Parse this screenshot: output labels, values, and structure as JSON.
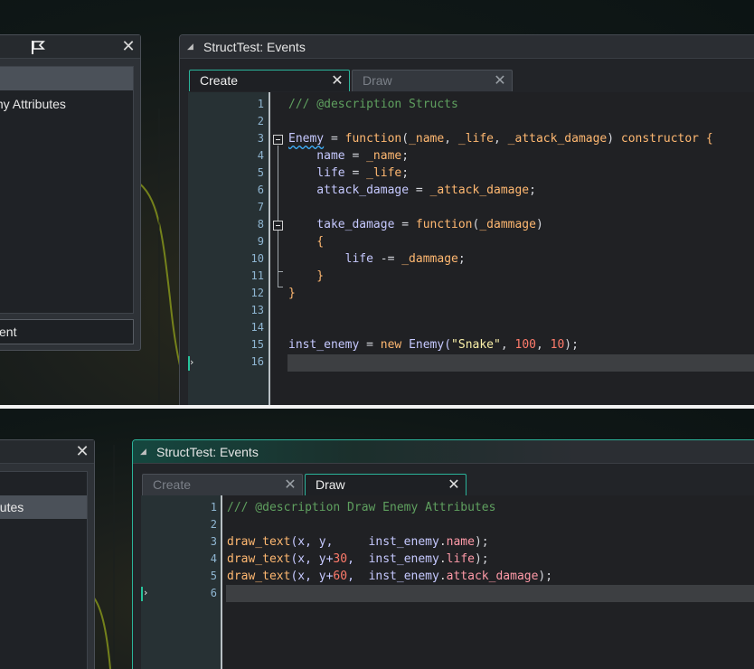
{
  "top": {
    "left_window": {
      "rows": [
        "",
        "my Attributes"
      ],
      "field_value": "vent"
    },
    "events_window": {
      "title": "StructTest: Events",
      "tabs": [
        {
          "label": "Create",
          "active": true
        },
        {
          "label": "Draw",
          "active": false
        }
      ],
      "line_numbers": [
        "1",
        "2",
        "3",
        "4",
        "5",
        "6",
        "7",
        "8",
        "9",
        "10",
        "11",
        "12",
        "13",
        "14",
        "15",
        "16"
      ],
      "code": {
        "l1": "/// @description Structs",
        "l3_a": "Enemy",
        "l3_b": " = ",
        "l3_c": "function",
        "l3_d": "(",
        "l3_e": "_name",
        "l3_f": ", ",
        "l3_g": "_life",
        "l3_h": ", ",
        "l3_i": "_attack_damage",
        "l3_j": ") ",
        "l3_k": "constructor",
        "l3_l": " {",
        "l4_a": "    name",
        "l4_b": " = ",
        "l4_c": "_name",
        "l4_d": ";",
        "l5_a": "    life",
        "l5_b": " = ",
        "l5_c": "_life",
        "l5_d": ";",
        "l6_a": "    attack_damage",
        "l6_b": " = ",
        "l6_c": "_attack_damage",
        "l6_d": ";",
        "l8_a": "    take_damage",
        "l8_b": " = ",
        "l8_c": "function",
        "l8_d": "(",
        "l8_e": "_dammage",
        "l8_f": ")",
        "l9": "    {",
        "l10_a": "        life",
        "l10_b": " -= ",
        "l10_c": "_dammage",
        "l10_d": ";",
        "l11": "    }",
        "l12": "}",
        "l15_a": "inst_enemy",
        "l15_b": " = ",
        "l15_c": "new",
        "l15_d": " Enemy(",
        "l15_e": "\"Snake\"",
        "l15_f": ", ",
        "l15_g": "100",
        "l15_h": ", ",
        "l15_i": "10",
        "l15_j": ");"
      }
    }
  },
  "bottom": {
    "left_window": {
      "rows": [
        "",
        "butes"
      ]
    },
    "events_window": {
      "title": "StructTest: Events",
      "tabs": [
        {
          "label": "Create",
          "active": false
        },
        {
          "label": "Draw",
          "active": true
        }
      ],
      "line_numbers": [
        "1",
        "2",
        "3",
        "4",
        "5",
        "6"
      ],
      "code": {
        "l1": "/// @description Draw Enemy Attributes",
        "l3_a": "draw_text",
        "l3_b": "(x, y,     ",
        "l3_c": "inst_enemy",
        "l3_d": ".",
        "l3_e": "name",
        "l3_f": ");",
        "l4_a": "draw_text",
        "l4_b": "(x, y+",
        "l4_n": "30",
        "l4_b2": ",  ",
        "l4_c": "inst_enemy",
        "l4_d": ".",
        "l4_e": "life",
        "l4_f": ");",
        "l5_a": "draw_text",
        "l5_b": "(x, y+",
        "l5_n": "60",
        "l5_b2": ",  ",
        "l5_c": "inst_enemy",
        "l5_d": ".",
        "l5_e": "attack_damage",
        "l5_f": ");"
      }
    }
  },
  "icons": {
    "flag": "flag-icon",
    "close": "close-icon",
    "collapse": "collapse-triangle-icon",
    "fold": "fold-minus-icon",
    "caret": "caret-right-icon"
  },
  "colors": {
    "accent_teal": "#2bb39a",
    "comment": "#5fa05f",
    "keyword": "#ffb871",
    "number": "#ff7b6b",
    "string": "#fbf1a9",
    "field": "#ff9aa8"
  }
}
